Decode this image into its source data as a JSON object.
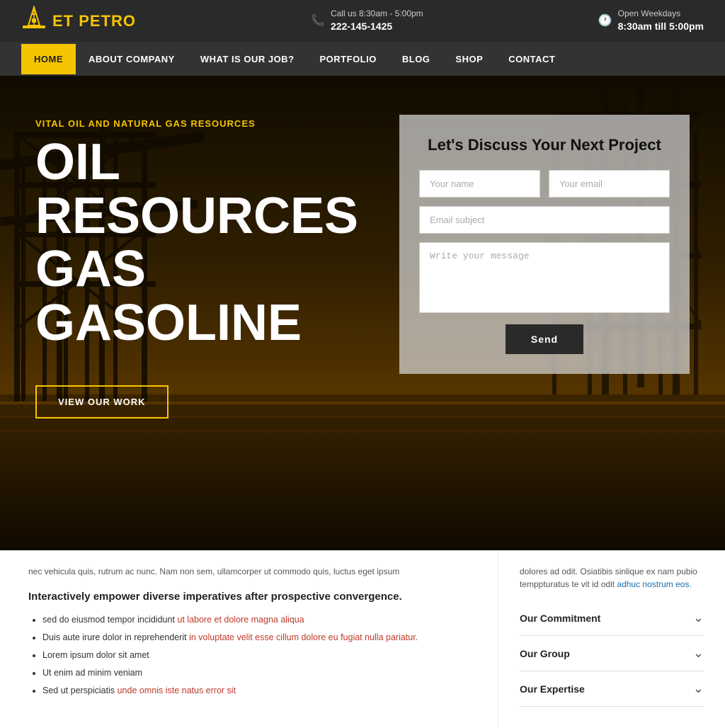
{
  "brand": {
    "logo_icon": "⛽",
    "name_part1": "ET ",
    "name_part2": "PETRO"
  },
  "topbar": {
    "contact_label": "Call us 8:30am - 5:00pm",
    "contact_number": "222-145-1425",
    "hours_label": "Open Weekdays",
    "hours_value": "8:30am till 5:00pm"
  },
  "nav": {
    "items": [
      {
        "label": "HOME",
        "active": true
      },
      {
        "label": "ABOUT COMPANY",
        "active": false
      },
      {
        "label": "WHAT IS OUR JOB?",
        "active": false
      },
      {
        "label": "PORTFOLIO",
        "active": false
      },
      {
        "label": "BLOG",
        "active": false
      },
      {
        "label": "SHOP",
        "active": false
      },
      {
        "label": "CONTACT",
        "active": false
      }
    ]
  },
  "hero": {
    "tagline": "VITAL OIL AND NATURAL GAS RESOURCES",
    "title_line1": "OIL",
    "title_line2": "RESOURCES",
    "title_line3": "GAS",
    "title_line4": "GASOLINE",
    "cta_label": "VIEW OUR WORK"
  },
  "contact_form": {
    "title": "Let's Discuss Your Next Project",
    "name_placeholder": "Your name",
    "email_placeholder": "Your email",
    "subject_placeholder": "Email subject",
    "message_placeholder": "Write your message",
    "send_label": "Send"
  },
  "bottom": {
    "lorem_text": "nec vehicula quis, rutrum ac nunc. Nam non sem, ullamcorper ut commodo quis, luctus eget ipsum",
    "intro_heading": "Interactively empower diverse imperatives after prospective convergence.",
    "list_items": [
      {
        "text": "sed do eiusmod tempor incididunt",
        "link_text": "ut labore et dolore magna aliqua",
        "link_href": "#"
      },
      {
        "text": "Duis aute irure dolor in reprehenderit",
        "link_text": "in voluptate velit esse cillum dolore eu fugiat nulla pariatur.",
        "link_href": "#"
      },
      {
        "text": "Lorem ipsum dolor sit amet",
        "link_text": "",
        "link_href": ""
      },
      {
        "text": "Ut enim ad minim veniam",
        "link_text": "",
        "link_href": ""
      },
      {
        "text": "Sed ut perspiciatis",
        "link_text": "unde omnis iste natus error sit",
        "link_href": "#"
      }
    ],
    "right_text": "dolores ad odit. Osiatibis sinlique ex nam pubio temppturatus te vit id odit adhuc nostrum eos.",
    "right_link_text": "adhuc nostrum eos.",
    "accordion": [
      {
        "title": "Our Commitment"
      },
      {
        "title": "Our Group"
      },
      {
        "title": "Our Expertise"
      }
    ]
  }
}
